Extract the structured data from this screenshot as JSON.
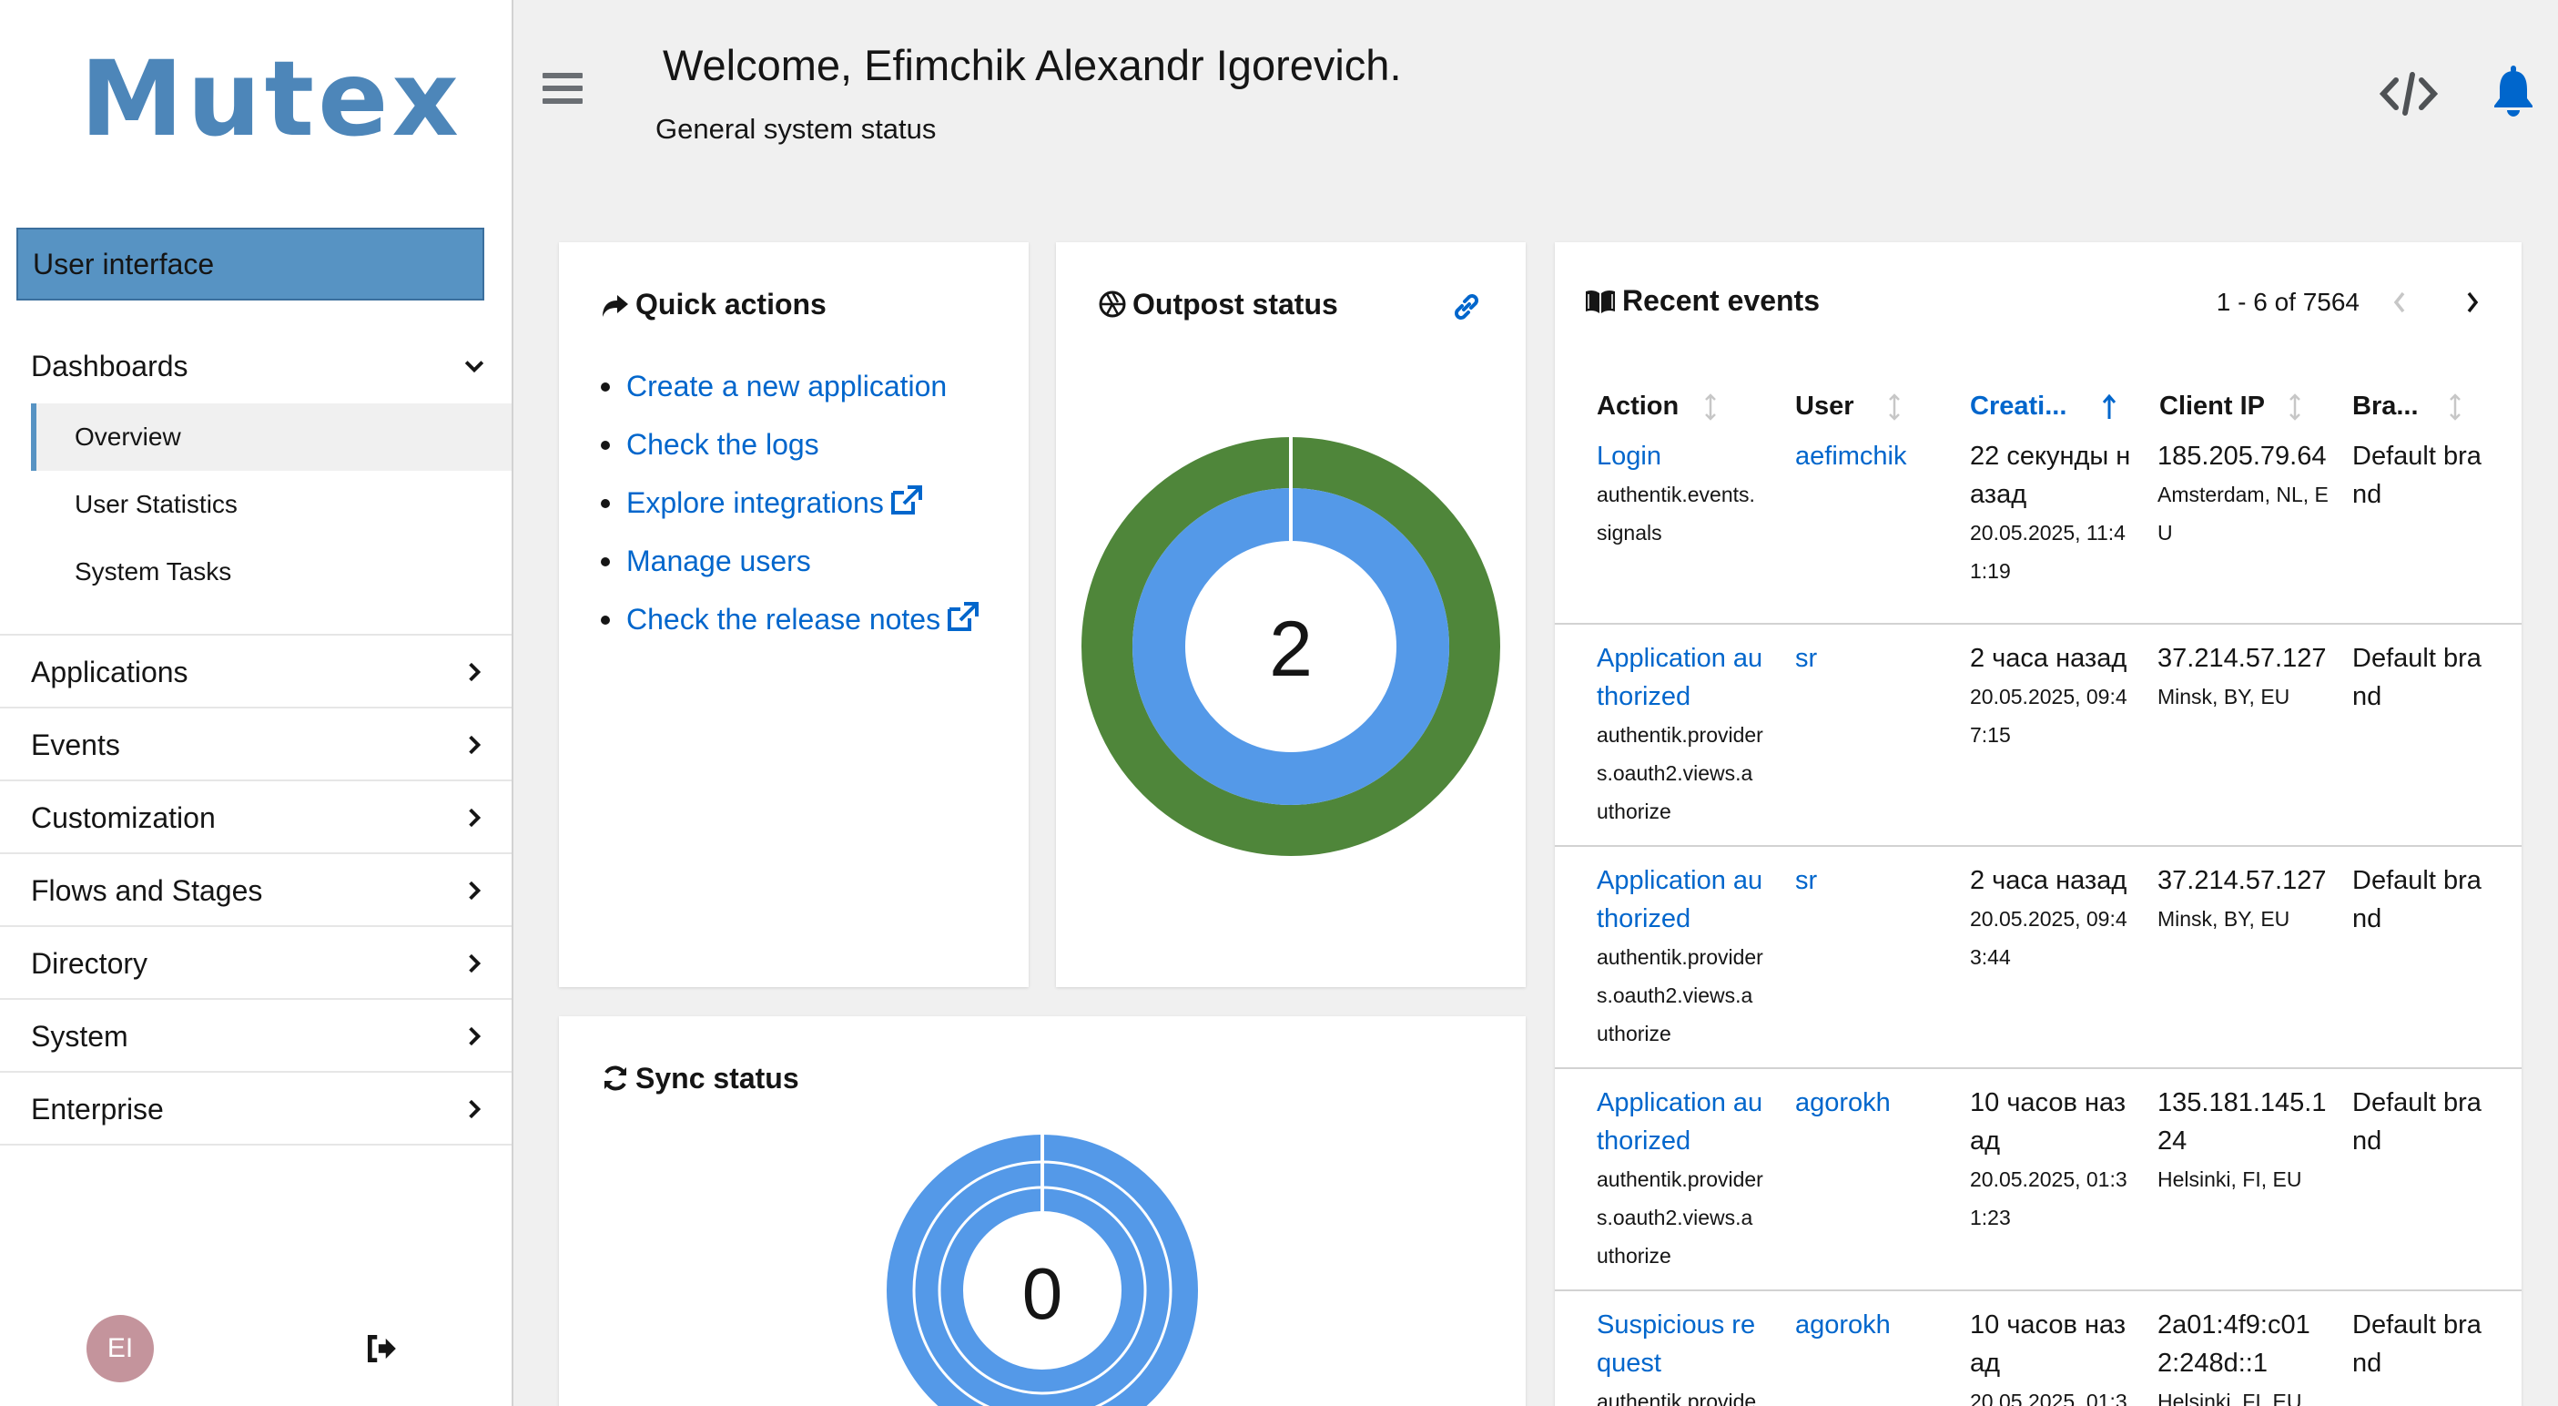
{
  "app": {
    "logo": "Mutex",
    "user_interface_label": "User interface",
    "avatar_initials": "EI"
  },
  "sidebar": {
    "dashboards": "Dashboards",
    "sub_items": [
      "Overview",
      "User Statistics",
      "System Tasks"
    ],
    "items": [
      "Applications",
      "Events",
      "Customization",
      "Flows and Stages",
      "Directory",
      "System",
      "Enterprise"
    ]
  },
  "header": {
    "welcome": "Welcome, Efimchik Alexandr Igorevich.",
    "subtitle": "General system status"
  },
  "quick_actions": {
    "title": "Quick actions",
    "links": [
      "Create a new application",
      "Check the logs",
      "Explore integrations",
      "Manage users",
      "Check the release notes"
    ]
  },
  "outpost_status": {
    "title": "Outpost status",
    "value": "2",
    "colors": {
      "outer": "#4f863a",
      "inner": "#5499e8"
    }
  },
  "sync_status": {
    "title": "Sync status",
    "value": "0",
    "color": "#5499e8"
  },
  "recent_events": {
    "title": "Recent events",
    "pager": "1 - 6 of 7564",
    "columns": [
      "Action",
      "User",
      "Creati...",
      "Client IP",
      "Bra..."
    ],
    "rows": [
      {
        "action": "Login",
        "action_detail": "authentik.events.signals",
        "user": "aefimchik",
        "created": "22 секунды назад",
        "created_detail": "20.05.2025, 11:41:19",
        "ip": "185.205.79.64",
        "ip_detail": "Amsterdam, NL, EU",
        "brand": "Default brand"
      },
      {
        "action": "Application authorized",
        "action_detail": "authentik.providers.oauth2.views.authorize",
        "user": "sr",
        "created": "2 часа назад",
        "created_detail": "20.05.2025, 09:47:15",
        "ip": "37.214.57.127",
        "ip_detail": "Minsk, BY, EU",
        "brand": "Default brand"
      },
      {
        "action": "Application authorized",
        "action_detail": "authentik.providers.oauth2.views.authorize",
        "user": "sr",
        "created": "2 часа назад",
        "created_detail": "20.05.2025, 09:43:44",
        "ip": "37.214.57.127",
        "ip_detail": "Minsk, BY, EU",
        "brand": "Default brand"
      },
      {
        "action": "Application authorized",
        "action_detail": "authentik.providers.oauth2.views.authorize",
        "user": "agorokh",
        "created": "10 часов назад",
        "created_detail": "20.05.2025, 01:31:23",
        "ip": "135.181.145.124",
        "ip_detail": "Helsinki, FI, EU",
        "brand": "Default brand"
      },
      {
        "action": "Suspicious request",
        "action_detail": "authentik.provide",
        "user": "agorokh",
        "created": "10 часов назад",
        "created_detail": "20.05.2025, 01:3",
        "ip": "2a01:4f9:c012:248d::1",
        "ip_detail": "Helsinki, FI, EU",
        "brand": "Default brand"
      }
    ]
  }
}
